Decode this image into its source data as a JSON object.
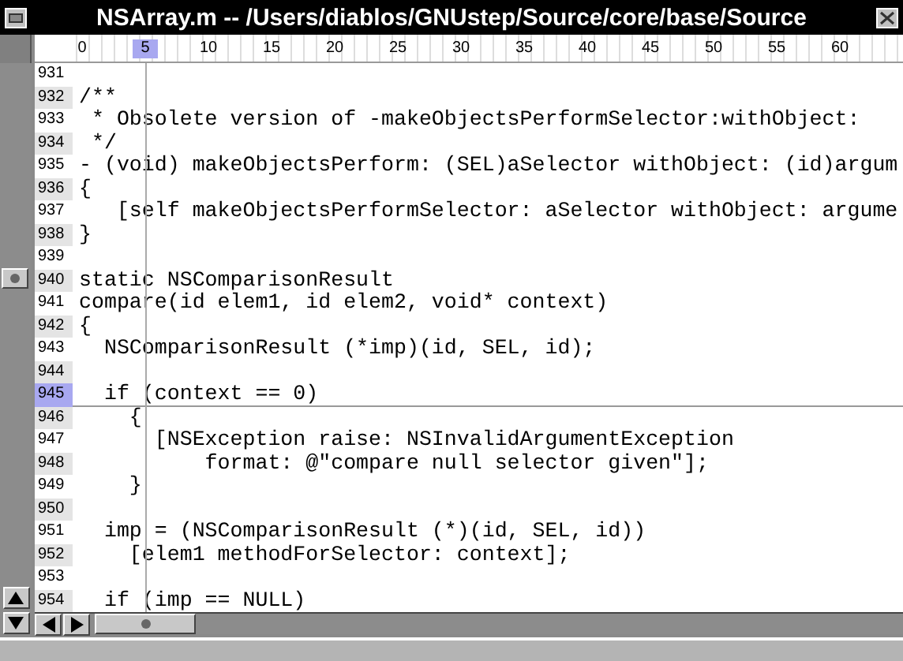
{
  "window": {
    "title": "NSArray.m -- /Users/diablos/GNUstep/Source/core/base/Source"
  },
  "ruler": {
    "marks": [
      {
        "label": "0",
        "selected": false
      },
      {
        "label": "5",
        "selected": true
      },
      {
        "label": "10",
        "selected": false
      },
      {
        "label": "15",
        "selected": false
      },
      {
        "label": "20",
        "selected": false
      },
      {
        "label": "25",
        "selected": false
      },
      {
        "label": "30",
        "selected": false
      },
      {
        "label": "35",
        "selected": false
      },
      {
        "label": "40",
        "selected": false
      },
      {
        "label": "45",
        "selected": false
      },
      {
        "label": "50",
        "selected": false
      },
      {
        "label": "55",
        "selected": false
      },
      {
        "label": "60",
        "selected": false
      }
    ]
  },
  "lines": [
    {
      "number": "931",
      "selected": false
    },
    {
      "number": "932",
      "text": "/**",
      "selected": false
    },
    {
      "number": "933",
      "text": " * Obsolete version of -makeObjectsPerformSelector:withObject:",
      "selected": false
    },
    {
      "number": "934",
      "text": " */",
      "selected": false
    },
    {
      "number": "935",
      "text": "- (void) makeObjectsPerform: (SEL)aSelector withObject: (id)argum",
      "selected": false
    },
    {
      "number": "936",
      "text": "{",
      "selected": false
    },
    {
      "number": "937",
      "text": "   [self makeObjectsPerformSelector: aSelector withObject: argume",
      "selected": false
    },
    {
      "number": "938",
      "text": "}",
      "selected": false
    },
    {
      "number": "939",
      "selected": false
    },
    {
      "number": "940",
      "text": "static NSComparisonResult",
      "selected": false
    },
    {
      "number": "941",
      "text": "compare(id elem1, id elem2, void* context)",
      "selected": false
    },
    {
      "number": "942",
      "text": "{",
      "selected": false
    },
    {
      "number": "943",
      "text": "  NSComparisonResult (*imp)(id, SEL, id);",
      "selected": false
    },
    {
      "number": "944",
      "selected": false
    },
    {
      "number": "945",
      "text": "  if (context == 0)",
      "selected": true
    },
    {
      "number": "946",
      "text": "    {",
      "selected": false
    },
    {
      "number": "947",
      "text": "      [NSException raise: NSInvalidArgumentException",
      "selected": false
    },
    {
      "number": "948",
      "text": "          format: @\"compare null selector given\"];",
      "selected": false
    },
    {
      "number": "949",
      "text": "    }",
      "selected": false
    },
    {
      "number": "950",
      "selected": false
    },
    {
      "number": "951",
      "text": "  imp = (NSComparisonResult (*)(id, SEL, id))",
      "selected": false
    },
    {
      "number": "952",
      "text": "    [elem1 methodForSelector: context];",
      "selected": false
    },
    {
      "number": "953",
      "selected": false
    },
    {
      "number": "954",
      "text": "  if (imp == NULL)",
      "selected": false
    }
  ]
}
